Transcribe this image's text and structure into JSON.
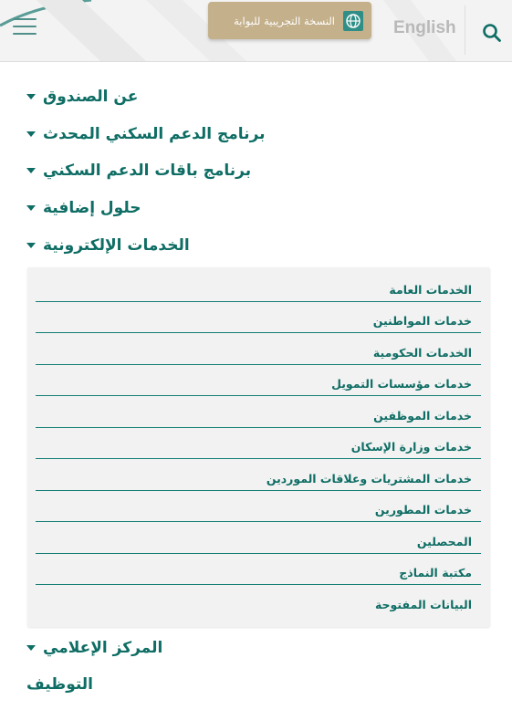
{
  "header": {
    "beta_label": "النسخة التجريبية للبوابة",
    "language_label": "English"
  },
  "menu": [
    {
      "label": "عن الصندوق",
      "has_dropdown": true
    },
    {
      "label": "برنامج الدعم السكني المحدث",
      "has_dropdown": true
    },
    {
      "label": "برنامج باقات الدعم السكني",
      "has_dropdown": true
    },
    {
      "label": "حلول إضافية",
      "has_dropdown": true
    },
    {
      "label": "الخدمات الإلكترونية",
      "has_dropdown": true,
      "expanded": true
    },
    {
      "label": "المركز الإعلامي",
      "has_dropdown": true
    },
    {
      "label": "التوظيف",
      "has_dropdown": false
    }
  ],
  "eservices_submenu": [
    "الخدمات العامة",
    "خدمات المواطنين",
    "الخدمات الحكومية",
    "خدمات مؤسسات التمويل",
    "خدمات الموظفين",
    "خدمات وزارة الإسكان",
    "خدمات المشتريات وعلاقات الموردين",
    "خدمات المطورين",
    "المحصلين",
    "مكتبة النماذج",
    "البيانات المفتوحة"
  ],
  "colors": {
    "primary": "#0e6d64",
    "beta_button": "#c4b08a",
    "header_bg": "#f3f3f3",
    "submenu_bg": "#f2f2f2"
  },
  "icons": [
    "hamburger-icon",
    "globe-icon",
    "search-icon",
    "caret-down-icon"
  ]
}
